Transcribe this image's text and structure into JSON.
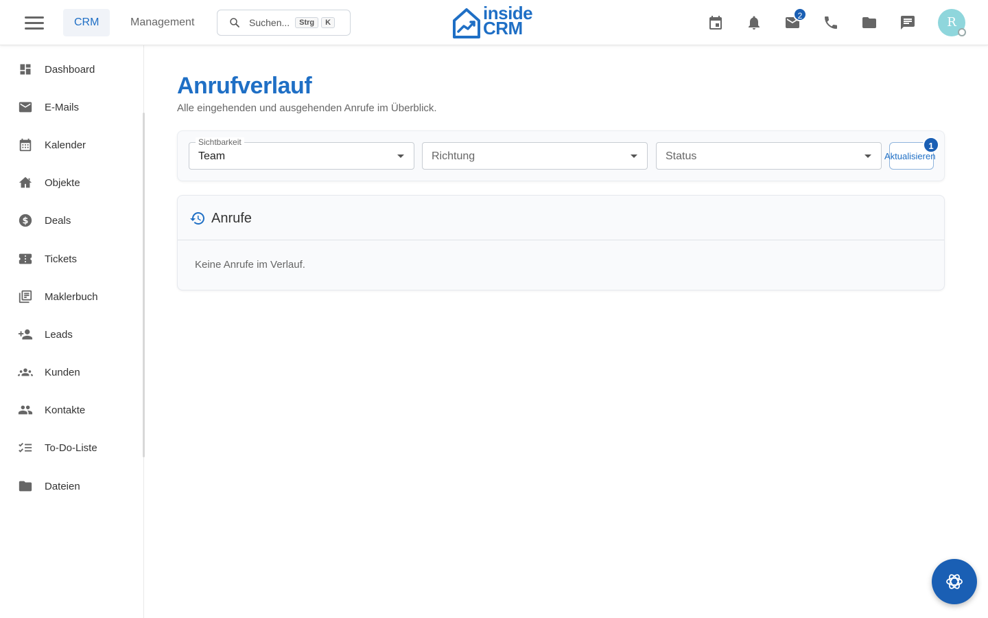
{
  "header": {
    "tabs": [
      {
        "label": "CRM",
        "active": true
      },
      {
        "label": "Management",
        "active": false
      }
    ],
    "search": {
      "placeholder": "Suchen...",
      "shortcut_keys": [
        "Strg",
        "K"
      ]
    },
    "logo": {
      "line1": "inside",
      "line2": "CRM"
    },
    "icons": [
      "calendar-icon",
      "bell-icon",
      "mail-icon",
      "phone-icon",
      "folder-icon",
      "chat-icon"
    ],
    "mail_badge": "2",
    "avatar_initial": "R"
  },
  "sidebar": {
    "items": [
      {
        "label": "Dashboard",
        "icon": "dashboard-icon"
      },
      {
        "label": "E-Mails",
        "icon": "mail-icon"
      },
      {
        "label": "Kalender",
        "icon": "calendar-icon"
      },
      {
        "label": "Objekte",
        "icon": "home-icon"
      },
      {
        "label": "Deals",
        "icon": "dollar-icon"
      },
      {
        "label": "Tickets",
        "icon": "ticket-icon"
      },
      {
        "label": "Maklerbuch",
        "icon": "library-icon"
      },
      {
        "label": "Leads",
        "icon": "person-add-icon"
      },
      {
        "label": "Kunden",
        "icon": "groups-icon"
      },
      {
        "label": "Kontakte",
        "icon": "people-icon"
      },
      {
        "label": "To-Do-Liste",
        "icon": "checklist-icon"
      },
      {
        "label": "Dateien",
        "icon": "folder-icon"
      }
    ]
  },
  "main": {
    "title": "Anrufverlauf",
    "subtitle": "Alle eingehenden und ausgehenden Anrufe im Überblick.",
    "filters": {
      "visibility": {
        "label": "Sichtbarkeit",
        "value": "Team"
      },
      "direction": {
        "placeholder": "Richtung"
      },
      "status": {
        "placeholder": "Status"
      },
      "refresh_label": "Aktualisieren",
      "refresh_badge": "1"
    },
    "calls": {
      "title": "Anrufe",
      "empty_text": "Keine Anrufe im Verlauf."
    }
  },
  "colors": {
    "accent": "#1f6fc5",
    "badge": "#1a5fb4",
    "avatar": "#8fd6dc"
  }
}
